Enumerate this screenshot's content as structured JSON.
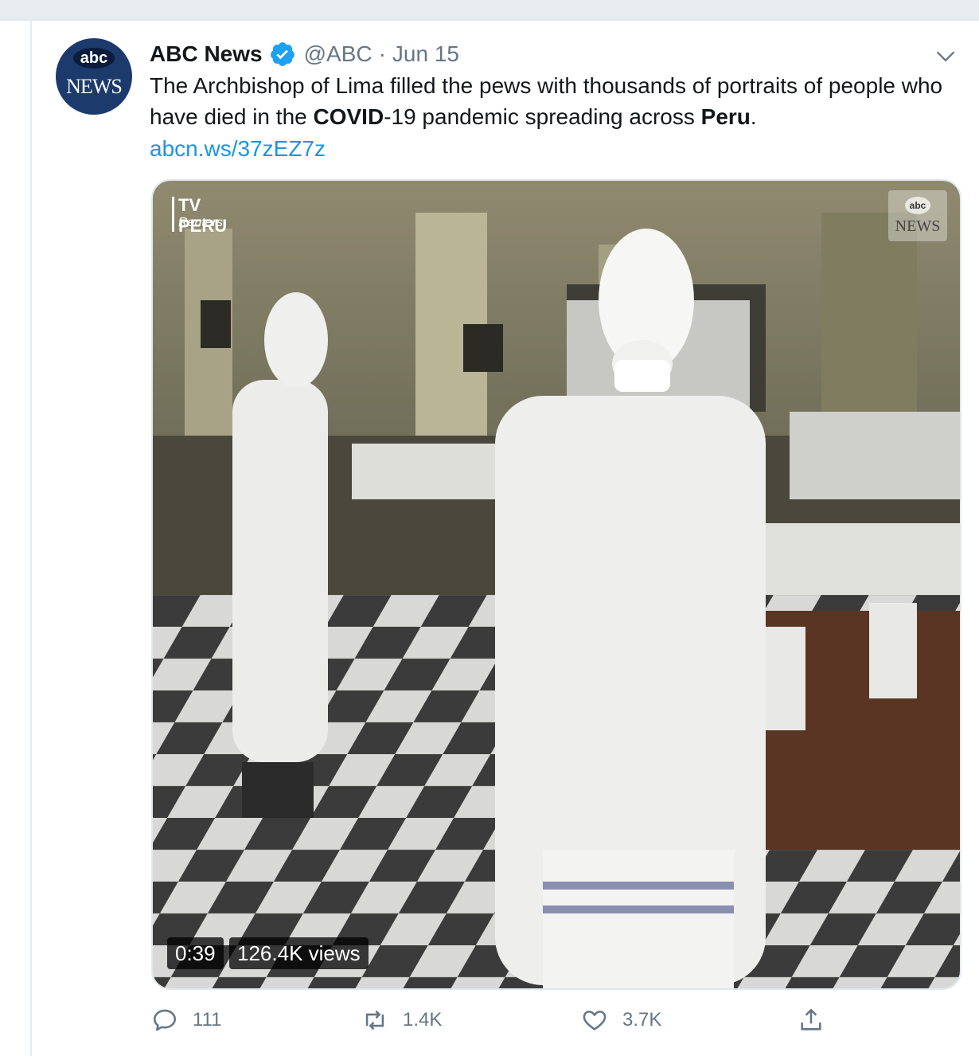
{
  "tweet": {
    "avatar": {
      "abc": "abc",
      "news": "NEWS"
    },
    "author_name": "ABC News",
    "handle": "@ABC",
    "separator": "·",
    "date": "Jun 15",
    "text": {
      "part1": "The Archbishop of Lima filled the pews with thousands of portraits of people who have died in the ",
      "bold1": "COVID",
      "part2": "-19 pandemic spreading across ",
      "bold2": "Peru",
      "part3": "."
    },
    "link": "abcn.ws/37zEZ7z"
  },
  "media": {
    "watermark_left": {
      "line1": "TV PERU",
      "line2": "Reuters"
    },
    "watermark_right": {
      "abc": "abc",
      "news": "NEWS"
    },
    "duration": "0:39",
    "views": "126.4K views"
  },
  "actions": {
    "reply_count": "111",
    "retweet_count": "1.4K",
    "like_count": "3.7K"
  },
  "colors": {
    "link": "#1b95e0",
    "muted": "#657786",
    "verified": "#1da1f2"
  }
}
